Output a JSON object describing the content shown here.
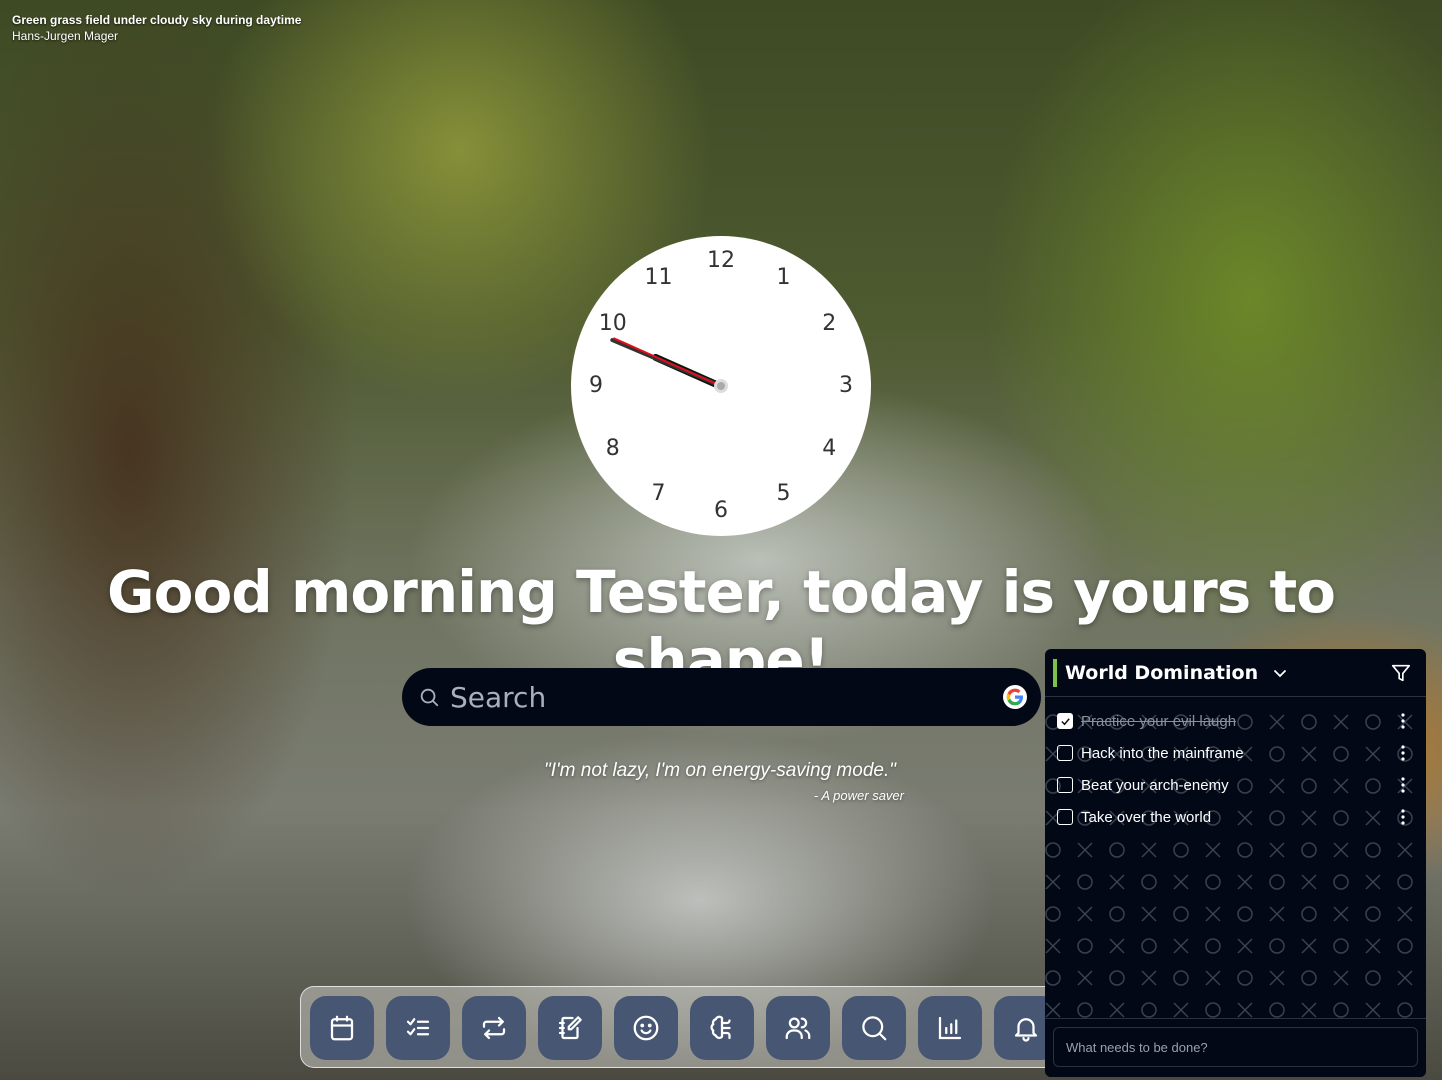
{
  "background": {
    "title": "Green grass field under cloudy sky during daytime",
    "author": "Hans-Jurgen Mager"
  },
  "clock": {
    "numbers": [
      "12",
      "1",
      "2",
      "3",
      "4",
      "5",
      "6",
      "7",
      "8",
      "9",
      "10",
      "11"
    ],
    "time": {
      "hours": 9,
      "minutes": 48,
      "seconds": 49
    }
  },
  "greeting": "Good morning Tester, today is yours to shape!",
  "search": {
    "placeholder": "Search",
    "icon": "search-icon",
    "engine_icon": "google-icon"
  },
  "quote": {
    "text": "\"I'm not lazy, I'm on energy-saving mode.\"",
    "author": "- A power saver"
  },
  "dock": {
    "items": [
      {
        "name": "calendar",
        "icon": "calendar-icon"
      },
      {
        "name": "todo",
        "icon": "checklist-icon"
      },
      {
        "name": "habits",
        "icon": "repeat-icon"
      },
      {
        "name": "notes",
        "icon": "notebook-icon"
      },
      {
        "name": "mood",
        "icon": "smile-icon"
      },
      {
        "name": "mind",
        "icon": "brain-icon"
      },
      {
        "name": "people",
        "icon": "users-icon"
      },
      {
        "name": "search",
        "icon": "search-icon"
      },
      {
        "name": "stats",
        "icon": "bar-chart-icon"
      },
      {
        "name": "notifications",
        "icon": "bell-icon"
      }
    ]
  },
  "todo": {
    "list_title": "World Domination",
    "accent": "#7cc14a",
    "items": [
      {
        "label": "Practice your evil laugh",
        "done": true
      },
      {
        "label": "Hack into the mainframe",
        "done": false
      },
      {
        "label": "Beat your arch-enemy",
        "done": false
      },
      {
        "label": "Take over the world",
        "done": false
      }
    ],
    "input_placeholder": "What needs to be done?"
  }
}
